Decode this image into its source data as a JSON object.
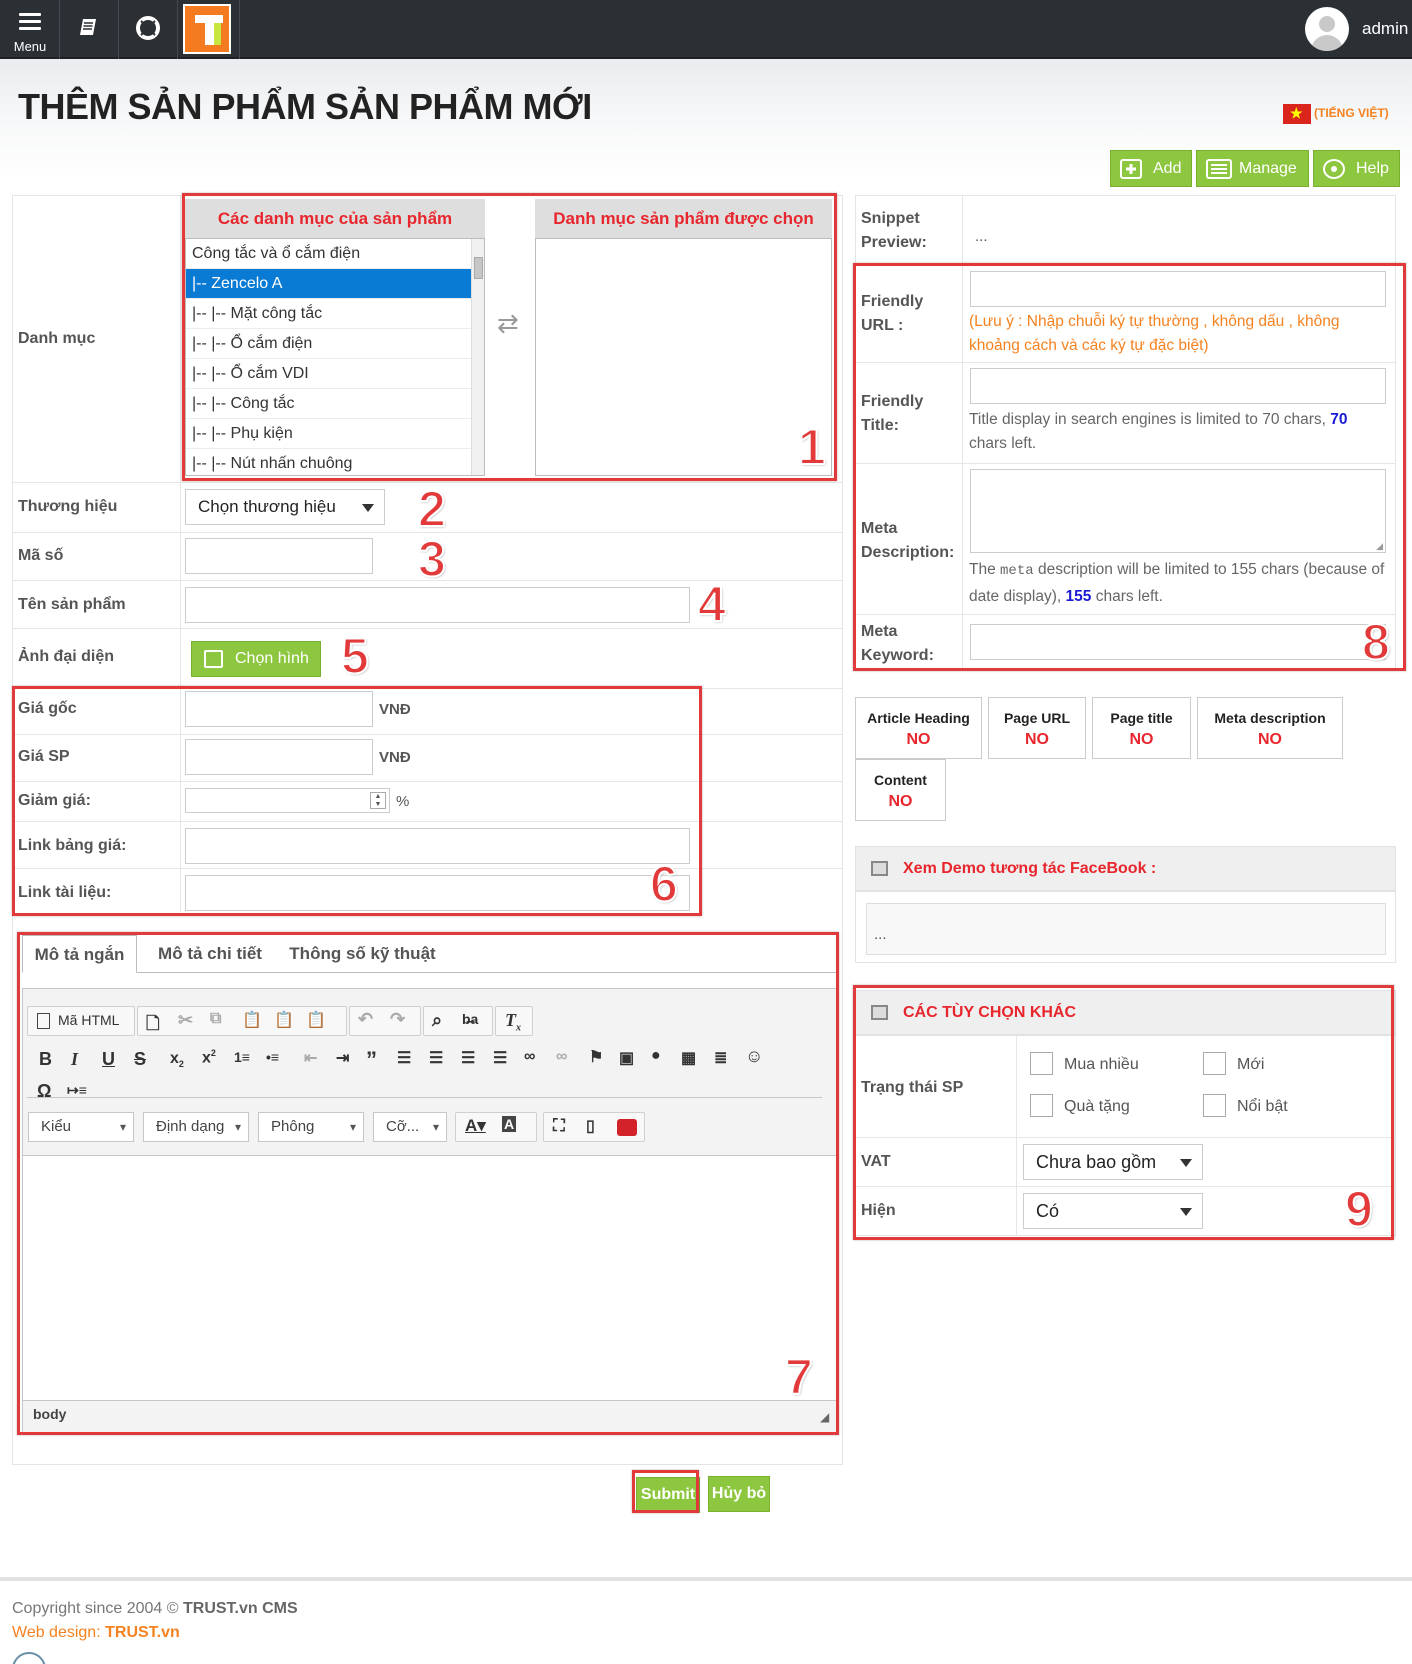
{
  "topbar": {
    "menu_label": "Menu",
    "user_name": "admin"
  },
  "page": {
    "title": "THÊM SẢN PHẨM SẢN PHẨM MỚI",
    "language": "(TIẾNG VIỆT)"
  },
  "actions": {
    "add": "Add",
    "manage": "Manage",
    "help": "Help"
  },
  "form": {
    "category": {
      "label": "Danh mục",
      "available_header": "Các danh mục của sản phẩm",
      "selected_header": "Danh mục sản phẩm được chọn",
      "items": [
        {
          "label": "Công tắc và ổ cắm điện",
          "selected": false
        },
        {
          "label": "|-- Zencelo A",
          "selected": true
        },
        {
          "label": "|-- |-- Mặt công tắc",
          "selected": false
        },
        {
          "label": "|-- |-- Ổ cắm điện",
          "selected": false
        },
        {
          "label": "|-- |-- Ổ cắm VDI",
          "selected": false
        },
        {
          "label": "|-- |-- Công tắc",
          "selected": false
        },
        {
          "label": "|-- |-- Phụ kiện",
          "selected": false
        },
        {
          "label": "|-- |-- Nút nhấn chuông",
          "selected": false
        }
      ]
    },
    "brand": {
      "label": "Thương hiệu",
      "value": "Chọn thương hiệu"
    },
    "code": {
      "label": "Mã số",
      "value": ""
    },
    "name": {
      "label": "Tên sản phẩm",
      "value": ""
    },
    "image": {
      "label": "Ảnh đại diện",
      "button": "Chọn hình"
    },
    "original_price": {
      "label": "Giá gốc",
      "unit": "VNĐ",
      "value": ""
    },
    "price": {
      "label": "Giá SP",
      "unit": "VNĐ",
      "value": ""
    },
    "discount": {
      "label": "Giảm giá:",
      "unit": "%",
      "value": ""
    },
    "price_list_link": {
      "label": "Link bảng giá:",
      "value": ""
    },
    "document_link": {
      "label": "Link tài liệu:",
      "value": ""
    },
    "tabs": [
      "Mô tả ngắn",
      "Mô tả chi tiết",
      "Thông số kỹ thuật"
    ],
    "editor": {
      "source_button": "Mã HTML",
      "style_combo": "Kiểu",
      "format_combo": "Định dạng",
      "font_combo": "Phông",
      "size_combo": "Cỡ...",
      "status_path": "body"
    },
    "submit": "Submit",
    "cancel": "Hủy bỏ"
  },
  "seo": {
    "snippet_label": "Snippet Preview:",
    "snippet_value": "...",
    "friendly_url_label": "Friendly URL :",
    "friendly_url_note": "(Lưu ý : Nhập chuỗi ký tự thường , không dấu , không khoảng cách và các ký tự đặc biệt)",
    "friendly_title_label": "Friendly Title:",
    "friendly_title_note_prefix": "Title display in search engines is limited to 70 chars,",
    "friendly_title_chars_left": "70",
    "friendly_title_note_suffix": "chars left.",
    "meta_desc_label": "Meta Description:",
    "meta_desc_note_1": "The",
    "meta_desc_code": "meta",
    "meta_desc_note_2": "description will be limited to 155 chars (because of date display),",
    "meta_desc_chars_left": "155",
    "meta_desc_note_3": "chars left.",
    "meta_keyword_label": "Meta Keyword:",
    "checks": [
      {
        "title": "Article Heading",
        "value": "NO"
      },
      {
        "title": "Page URL",
        "value": "NO"
      },
      {
        "title": "Page title",
        "value": "NO"
      },
      {
        "title": "Meta description",
        "value": "NO"
      },
      {
        "title": "Content",
        "value": "NO"
      }
    ]
  },
  "facebook": {
    "title": "Xem Demo tương tác FaceBook :",
    "preview": "..."
  },
  "options": {
    "title": "CÁC TÙY CHỌN KHÁC",
    "status_label": "Trạng thái SP",
    "status_options": [
      "Mua nhiều",
      "Mới",
      "Quà tặng",
      "Nổi bật"
    ],
    "vat_label": "VAT",
    "vat_value": "Chưa bao gồm",
    "visible_label": "Hiện",
    "visible_value": "Có"
  },
  "annotations": [
    "1",
    "2",
    "3",
    "4",
    "5",
    "6",
    "7",
    "8",
    "9"
  ],
  "footer": {
    "copyright": "Copyright since 2004 ©",
    "cms_name": "TRUST.vn CMS",
    "design_label": "Web design:",
    "design_name": "TRUST.vn"
  }
}
